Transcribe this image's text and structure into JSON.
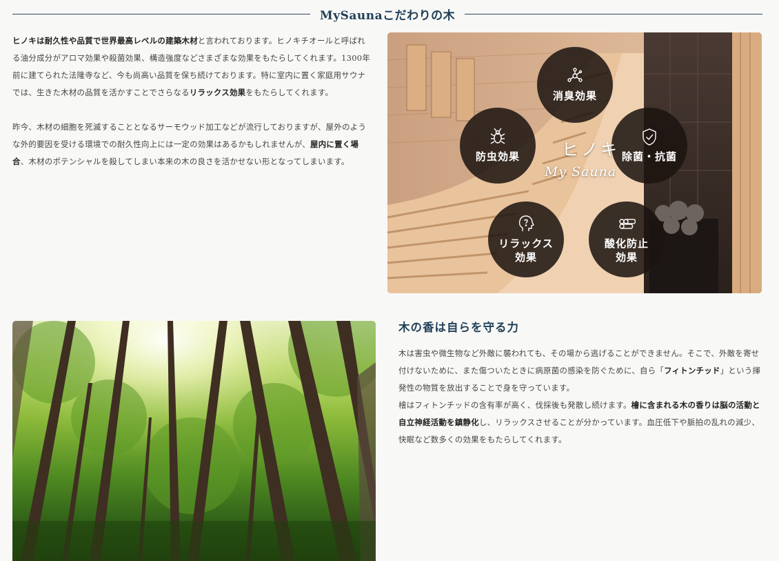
{
  "heading": {
    "title": "MySaunaこだわりの木"
  },
  "intro": {
    "p1": [
      {
        "text": "ヒノキは耐久性や品質で世界最高レベルの建築木材",
        "bold": true
      },
      {
        "text": "と言われております。ヒノキチオールと呼ばれる油分成分がアロマ効果や殺菌効果、構造強度などさまざまな効果をもたらしてくれます。1300年前に建てられた法隆寺など、今も尚高い品質を保ち続けております。特に室内に置く家庭用サウナでは、生きた木材の品質を活かすことでさらなる",
        "bold": false
      },
      {
        "text": "リラックス効果",
        "bold": true
      },
      {
        "text": "をもたらしてくれます。",
        "bold": false
      }
    ],
    "p2": [
      {
        "text": "昨今、木材の細胞を死滅することとなるサーモウッド加工などが流行しておりますが、屋外のような外的要因を受ける環境での耐久性向上には一定の効果はあるかもしれませんが、",
        "bold": false
      },
      {
        "text": "屋内に置く場合",
        "bold": true
      },
      {
        "text": "、木材のポテンシャルを殺してしまい本来の木の良さを活かせない形となってしまいます。",
        "bold": false
      }
    ]
  },
  "sauna_image": {
    "center_label": "ヒノキ",
    "brand": "My Sauna",
    "badges": [
      {
        "id": "deodorize",
        "label": "消臭効果",
        "icon": "molecule-icon"
      },
      {
        "id": "insect",
        "label": "防虫効果",
        "icon": "bug-icon"
      },
      {
        "id": "antibacterial",
        "label": "除菌・抗菌",
        "icon": "shield-check-icon"
      },
      {
        "id": "relax",
        "label": "リラックス\n効果",
        "icon": "head-mind-icon"
      },
      {
        "id": "antioxidant",
        "label": "酸化防止\n効果",
        "icon": "logs-icon"
      }
    ]
  },
  "aroma": {
    "title": "木の香は自らを守る力",
    "p1": [
      {
        "text": "木は害虫や微生物など外敵に襲われても、その場から逃げることができません。そこで、外敵を寄せ付けないために、また傷ついたときに病原菌の感染を防ぐために、自ら「",
        "bold": false
      },
      {
        "text": "フィトンチッド",
        "bold": true
      },
      {
        "text": "」という揮発性の物質を放出することで身を守っています。",
        "bold": false
      }
    ],
    "p2": [
      {
        "text": "檜はフィトンチッドの含有率が高く、伐採後も発散し続けます。",
        "bold": false
      },
      {
        "text": "檜に含まれる木の香りは脳の活動と自立神経活動を鎮静化",
        "bold": true
      },
      {
        "text": "し、リラックスさせることが分かっています。血圧低下や脈拍の乱れの減少、快眠など数多くの効果をもたらしてくれます。",
        "bold": false
      }
    ]
  },
  "colors": {
    "heading": "#1f3f58",
    "badge_bg": "#1c1410",
    "background": "#f8f8f6"
  }
}
